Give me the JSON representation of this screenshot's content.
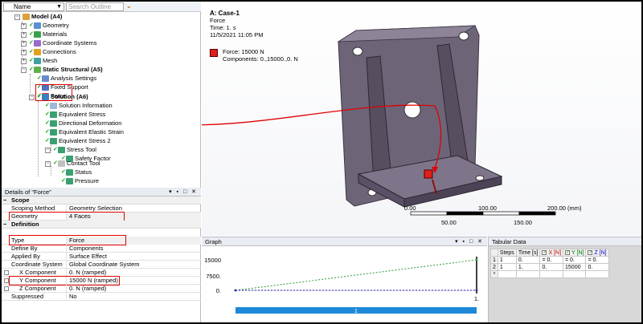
{
  "tree_header": {
    "name_label": "Name",
    "search_placeholder": "Search Outline"
  },
  "tree": {
    "model": "Model (A4)",
    "geometry": "Geometry",
    "materials": "Materials",
    "coordinate_systems": "Coordinate Systems",
    "connections": "Connections",
    "mesh": "Mesh",
    "static_structural": "Static Structural (A5)",
    "analysis_settings": "Analysis Settings",
    "fixed_support": "Fixed Support",
    "force": "Force",
    "solution": "Solution (A6)",
    "solution_information": "Solution Information",
    "equivalent_stress": "Equivalent Stress",
    "directional_deformation": "Directional Deformation",
    "equivalent_elastic_strain": "Equivalent Elastic Strain",
    "equivalent_stress_2": "Equivalent Stress 2",
    "stress_tool": "Stress Tool",
    "safety_factor": "Safety Factor",
    "contact_tool": "Contact Tool",
    "status": "Status",
    "pressure": "Pressure"
  },
  "details": {
    "title": "Details of \"Force\"",
    "controls": "▾ ▪ □ ✕",
    "scope_section": "Scope",
    "scoping_method_key": "Scoping Method",
    "scoping_method_val": "Geometry Selection",
    "geometry_key": "Geometry",
    "geometry_val": "4 Faces",
    "definition_section": "Definition",
    "type_key": "Type",
    "type_val": "Force",
    "define_by_key": "Define By",
    "define_by_val": "Components",
    "applied_by_key": "Applied By",
    "applied_by_val": "Surface Effect",
    "coord_sys_key": "Coordinate System",
    "coord_sys_val": "Global Coordinate System",
    "x_comp_key": "X Component",
    "x_comp_val": "0. N  (ramped)",
    "y_comp_key": "Y Component",
    "y_comp_val": "15000 N  (ramped)",
    "z_comp_key": "Z Component",
    "z_comp_val": "0. N  (ramped)",
    "suppressed_key": "Suppressed",
    "suppressed_val": "No"
  },
  "viewport": {
    "case": "A: Case-1",
    "load_name": "Force",
    "time": "Time: 1. s",
    "date": "11/5/2021 11:05 PM",
    "legend_force": "Force: 15000 N",
    "legend_components": "Components: 0.,15000.,0. N",
    "scale_0": "0.00",
    "scale_50": "50.00",
    "scale_100": "100.00",
    "scale_150": "150.00",
    "scale_200": "200.00 (mm)"
  },
  "graph": {
    "title": "Graph",
    "controls": "▾ ▪ □ ✕",
    "y_15000": "15000",
    "y_7500": "7500.",
    "y_0": "0.",
    "x_end": "1.",
    "step_label": "1"
  },
  "tabular": {
    "title": "Tabular Data",
    "columns": [
      "Steps",
      "Time [s]",
      "X [N]",
      "Y [N]",
      "Z [N]"
    ],
    "rows": [
      {
        "n": "1",
        "steps": "1",
        "time": "0.",
        "x": "= 0.",
        "y": "= 0.",
        "z": "= 0."
      },
      {
        "n": "2",
        "steps": "1",
        "time": "1.",
        "x": "0.",
        "y": "15000",
        "z": "0."
      },
      {
        "n": "*",
        "steps": "",
        "time": "",
        "x": "",
        "y": "",
        "z": ""
      }
    ]
  },
  "chart_data": {
    "type": "line",
    "x": [
      0,
      1
    ],
    "series": [
      {
        "name": "X",
        "values": [
          0,
          0
        ]
      },
      {
        "name": "Y",
        "values": [
          0,
          15000
        ]
      },
      {
        "name": "Z",
        "values": [
          0,
          0
        ]
      }
    ],
    "ylim": [
      0,
      15000
    ],
    "xlim": [
      0,
      1
    ],
    "yticks": [
      "15000",
      "7500.",
      "0."
    ],
    "title": "",
    "colors": {
      "X": "#c00000",
      "Y": "#2e9a2e",
      "Z": "#2020c0"
    }
  }
}
